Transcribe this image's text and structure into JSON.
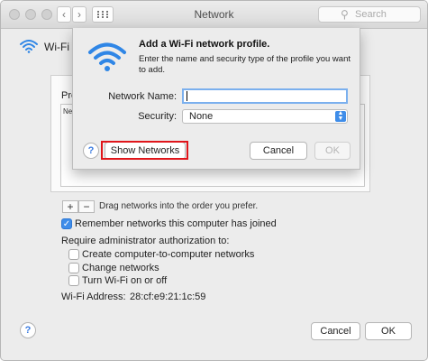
{
  "window": {
    "title": "Network"
  },
  "search": {
    "placeholder": "Search"
  },
  "sidebar": {
    "wifi_label": "Wi-Fi"
  },
  "panel": {
    "list_label": "Pre",
    "list_header": "Ne",
    "add_label": "+",
    "remove_label": "−",
    "drag_hint": "Drag networks into the order you prefer.",
    "remember_label": "Remember networks this computer has joined",
    "require_admin_label": "Require administrator authorization to:",
    "option_computer_networks": "Create computer-to-computer networks",
    "option_change_networks": "Change networks",
    "option_turn_wifi": "Turn Wi-Fi on or off",
    "wifi_address_label": "Wi-Fi Address:",
    "wifi_address_value": "28:cf:e9:21:1c:59",
    "help_label": "?",
    "cancel_label": "Cancel",
    "ok_label": "OK"
  },
  "sheet": {
    "title": "Add a Wi-Fi network profile.",
    "description": "Enter the name and security type of the profile you want to add.",
    "network_name_label": "Network Name:",
    "network_name_value": "",
    "security_label": "Security:",
    "security_value": "None",
    "help_label": "?",
    "show_networks_label": "Show Networks",
    "cancel_label": "Cancel",
    "ok_label": "OK"
  },
  "colors": {
    "accent": "#3f8de9",
    "highlight": "#e0161b",
    "wifi_blue": "#2f86e6"
  }
}
